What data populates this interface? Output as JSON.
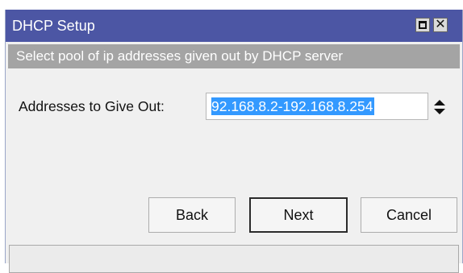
{
  "window": {
    "title": "DHCP Setup",
    "maximize_icon": "maximize-icon",
    "close_icon": "close-icon",
    "close_glyph": "✕"
  },
  "banner": {
    "text": "Select pool of ip addresses given out by DHCP server"
  },
  "form": {
    "addresses_label": "Addresses to Give Out:",
    "addresses_value": "92.168.8.2-192.168.8.254",
    "stepper_icon": "up-down-stepper-icon"
  },
  "buttons": {
    "back": "Back",
    "next": "Next",
    "cancel": "Cancel"
  },
  "status_bar": {
    "text": ""
  },
  "colors": {
    "titlebar": "#4c56a4",
    "banner": "#a4a4a4",
    "selection": "#3399ff"
  }
}
